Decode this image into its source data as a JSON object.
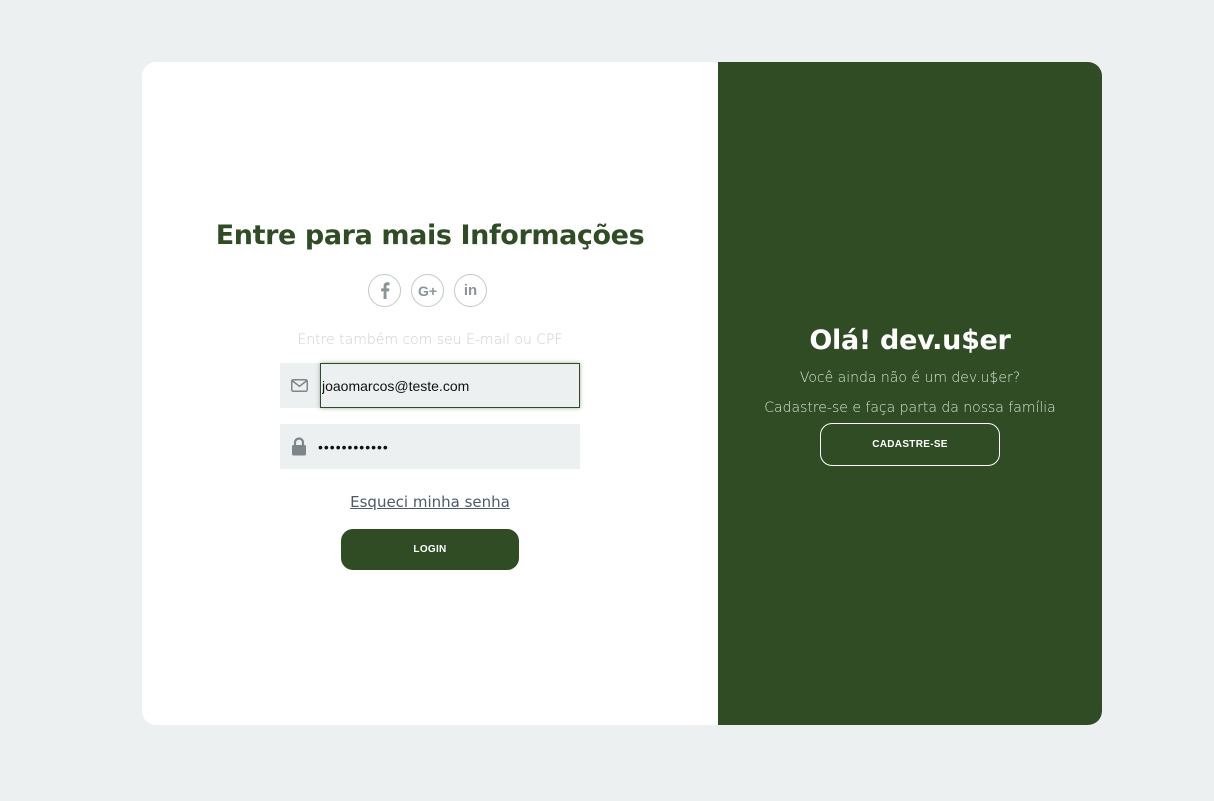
{
  "login": {
    "title": "Entre para mais Informações",
    "social": [
      {
        "icon": "facebook-icon",
        "label": "f"
      },
      {
        "icon": "google-plus-icon",
        "label": "G+"
      },
      {
        "icon": "linkedin-icon",
        "label": "in"
      }
    ],
    "subtitle": "Entre também com seu E-mail ou CPF",
    "email_value": "joaomarcos@teste.com",
    "email_icon": "envelope-icon",
    "password_value": "••••••••••••",
    "password_icon": "lock-icon",
    "forgot_label": "Esqueci minha senha",
    "login_label": "LOGIN"
  },
  "signup_panel": {
    "title": "Olá! dev.u$er",
    "text1": "Você ainda não é um dev.u$er?",
    "text2": "Cadastre-se e faça parta da nossa família",
    "button_label": "CADASTRE-SE"
  },
  "colors": {
    "brand_green": "#2f4c24",
    "page_background": "#ecf0f1",
    "input_background": "#ecf0f1"
  }
}
